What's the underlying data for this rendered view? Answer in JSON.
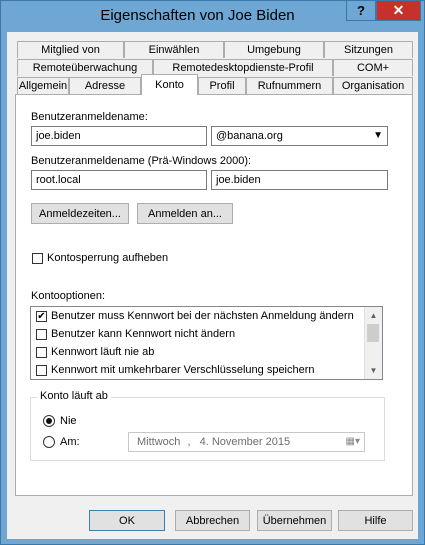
{
  "window": {
    "title": "Eigenschaften von Joe Biden",
    "help_label": "?",
    "close_label": "✕"
  },
  "tabs": {
    "row1": [
      "Mitglied von",
      "Einwählen",
      "Umgebung",
      "Sitzungen"
    ],
    "row2": [
      "Remoteüberwachung",
      "Remotedesktopdienste-Profil",
      "COM+"
    ],
    "row3": [
      "Allgemein",
      "Adresse",
      "Konto",
      "Profil",
      "Rufnummern",
      "Organisation"
    ],
    "active": "Konto"
  },
  "account": {
    "logon_label": "Benutzeranmeldename:",
    "logon_value": "joe.biden",
    "domain_value": "@banana.org",
    "pre2000_label": "Benutzeranmeldename (Prä-Windows 2000):",
    "pre2000_domain": "root.local",
    "pre2000_user": "joe.biden",
    "logon_hours_button": "Anmeldezeiten...",
    "logon_to_button": "Anmelden an...",
    "unlock_label": "Kontosperrung aufheben",
    "options_label": "Kontooptionen:",
    "options": [
      {
        "label": "Benutzer muss Kennwort bei der nächsten Anmeldung ändern",
        "checked": true
      },
      {
        "label": "Benutzer kann Kennwort nicht ändern",
        "checked": false
      },
      {
        "label": "Kennwort läuft nie ab",
        "checked": false
      },
      {
        "label": "Kennwort mit umkehrbarer Verschlüsselung speichern",
        "checked": false
      }
    ],
    "expires_label": "Konto läuft ab",
    "never_label": "Nie",
    "on_label": "Am:",
    "date_weekday": "Mittwoch",
    "date_sep": ",",
    "date_value": "4. November 2015",
    "expires_selected": "Nie"
  },
  "footer": {
    "ok": "OK",
    "cancel": "Abbrechen",
    "apply": "Übernehmen",
    "help": "Hilfe"
  }
}
